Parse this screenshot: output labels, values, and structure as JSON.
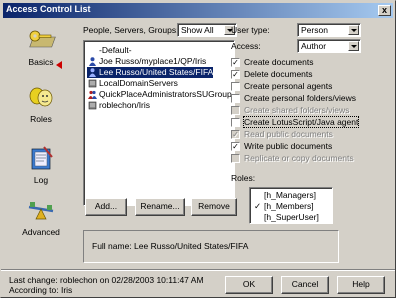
{
  "window": {
    "title": "Access Control List",
    "close_label": "x"
  },
  "sidebar": {
    "items": [
      {
        "label": "Basics",
        "icon": "key-icon"
      },
      {
        "label": "Roles",
        "icon": "masks-icon"
      },
      {
        "label": "Log",
        "icon": "log-book-icon"
      },
      {
        "label": "Advanced",
        "icon": "seesaw-icon"
      }
    ],
    "selected": "Basics"
  },
  "filter": {
    "label": "People, Servers, Groups:",
    "value": "Show All"
  },
  "entries": [
    {
      "name": "-Default-",
      "icon": "",
      "selected": false
    },
    {
      "name": "Joe Russo/myplace1/QP/Iris",
      "icon": "person-icon",
      "selected": false
    },
    {
      "name": "Lee Russo/United States/FIFA",
      "icon": "person-icon",
      "selected": true
    },
    {
      "name": "LocalDomainServers",
      "icon": "server-icon",
      "selected": false
    },
    {
      "name": "QuickPlaceAdministratorsSUGroup",
      "icon": "group-icon",
      "selected": false
    },
    {
      "name": "roblechon/Iris",
      "icon": "server-icon",
      "selected": false
    }
  ],
  "list_buttons": {
    "add": "Add...",
    "rename": "Rename...",
    "remove": "Remove"
  },
  "user_type": {
    "label": "User type:",
    "value": "Person"
  },
  "access": {
    "label": "Access:",
    "value": "Author"
  },
  "privileges": [
    {
      "label": "Create documents",
      "checked": true,
      "disabled": false
    },
    {
      "label": "Delete documents",
      "checked": true,
      "disabled": false
    },
    {
      "label": "Create personal agents",
      "checked": false,
      "disabled": false
    },
    {
      "label": "Create personal folders/views",
      "checked": false,
      "disabled": false
    },
    {
      "label": "Create shared folders/views",
      "checked": false,
      "disabled": true
    },
    {
      "label": "Create LotusScript/Java agent",
      "checked": false,
      "disabled": false,
      "focused": true
    },
    {
      "label": "Read public documents",
      "checked": true,
      "disabled": true
    },
    {
      "label": "Write public documents",
      "checked": true,
      "disabled": false
    },
    {
      "label": "Replicate or copy documents",
      "checked": false,
      "disabled": true
    }
  ],
  "roles": {
    "label": "Roles:",
    "items": [
      {
        "name": "[h_Managers]",
        "checked": false
      },
      {
        "name": "[h_Members]",
        "checked": true
      },
      {
        "name": "[h_SuperUser]",
        "checked": false
      }
    ]
  },
  "full_name": {
    "text": "Full name: Lee Russo/United States/FIFA"
  },
  "status": {
    "last_change": "Last change: roblechon on 02/28/2003 10:11:47 AM",
    "according_to": "According to: Iris"
  },
  "footer_buttons": {
    "ok": "OK",
    "cancel": "Cancel",
    "help": "Help"
  }
}
